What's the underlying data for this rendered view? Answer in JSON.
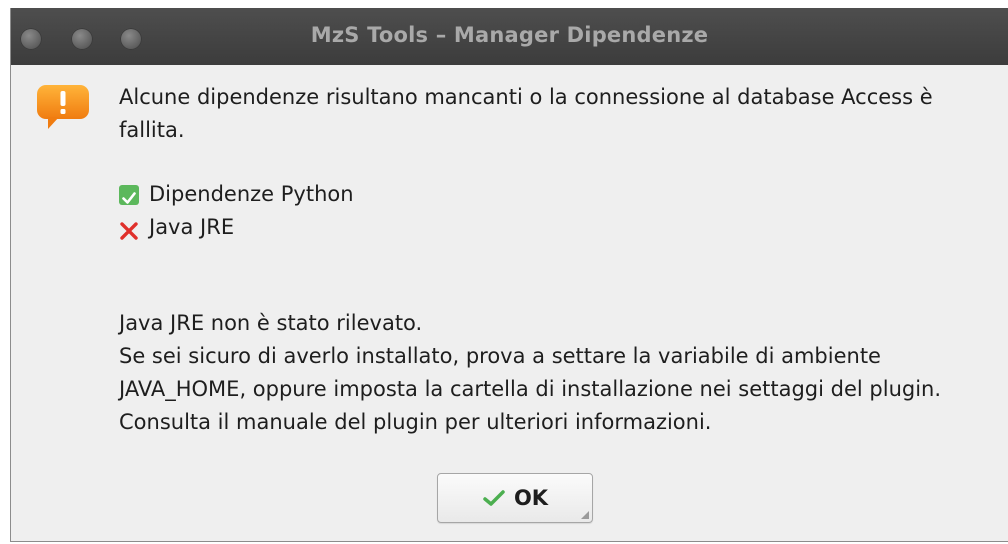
{
  "window": {
    "title": "MzS Tools – Manager Dipendenze"
  },
  "dialog": {
    "icon": "warning-icon",
    "message": "Alcune dipendenze risultano mancanti o la connessione al database Access è fallita.",
    "status_items": [
      {
        "label": "Dipendenze Python",
        "status": "ok",
        "icon": "check-mark-icon"
      },
      {
        "label": "Java JRE",
        "status": "missing",
        "icon": "cross-mark-icon"
      }
    ],
    "details": [
      "Java JRE non è stato rilevato.",
      "Se sei sicuro di averlo installato, prova a settare la variabile di ambiente",
      "JAVA_HOME, oppure imposta la cartella di installazione nei settaggi del plugin.",
      "Consulta il manuale del plugin per ulteriori informazioni."
    ]
  },
  "buttons": {
    "ok_label": "OK"
  },
  "colors": {
    "titlebar": "#464646",
    "dialog_background": "#efefef",
    "warning": "#f39c12",
    "ok": "#5cb85c",
    "error": "#e0302b"
  }
}
